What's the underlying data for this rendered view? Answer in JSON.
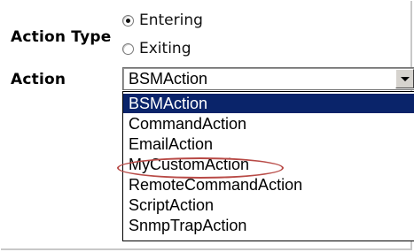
{
  "form": {
    "action_type_label": "Action Type",
    "action_label": "Action",
    "radio_options": [
      {
        "label": "Entering",
        "checked": true
      },
      {
        "label": "Exiting",
        "checked": false
      }
    ]
  },
  "action_select": {
    "selected_value": "BSMAction",
    "options": [
      "BSMAction",
      "CommandAction",
      "EmailAction",
      "MyCustomAction",
      "RemoteCommandAction",
      "ScriptAction",
      "SnmpTrapAction"
    ],
    "highlighted_option": "BSMAction",
    "circled_option": "MyCustomAction"
  },
  "colors": {
    "selection_bg": "#0a246a",
    "circle_annotation": "#b84a46"
  },
  "icons": {
    "dropdown_arrow": "chevron-down-icon"
  }
}
